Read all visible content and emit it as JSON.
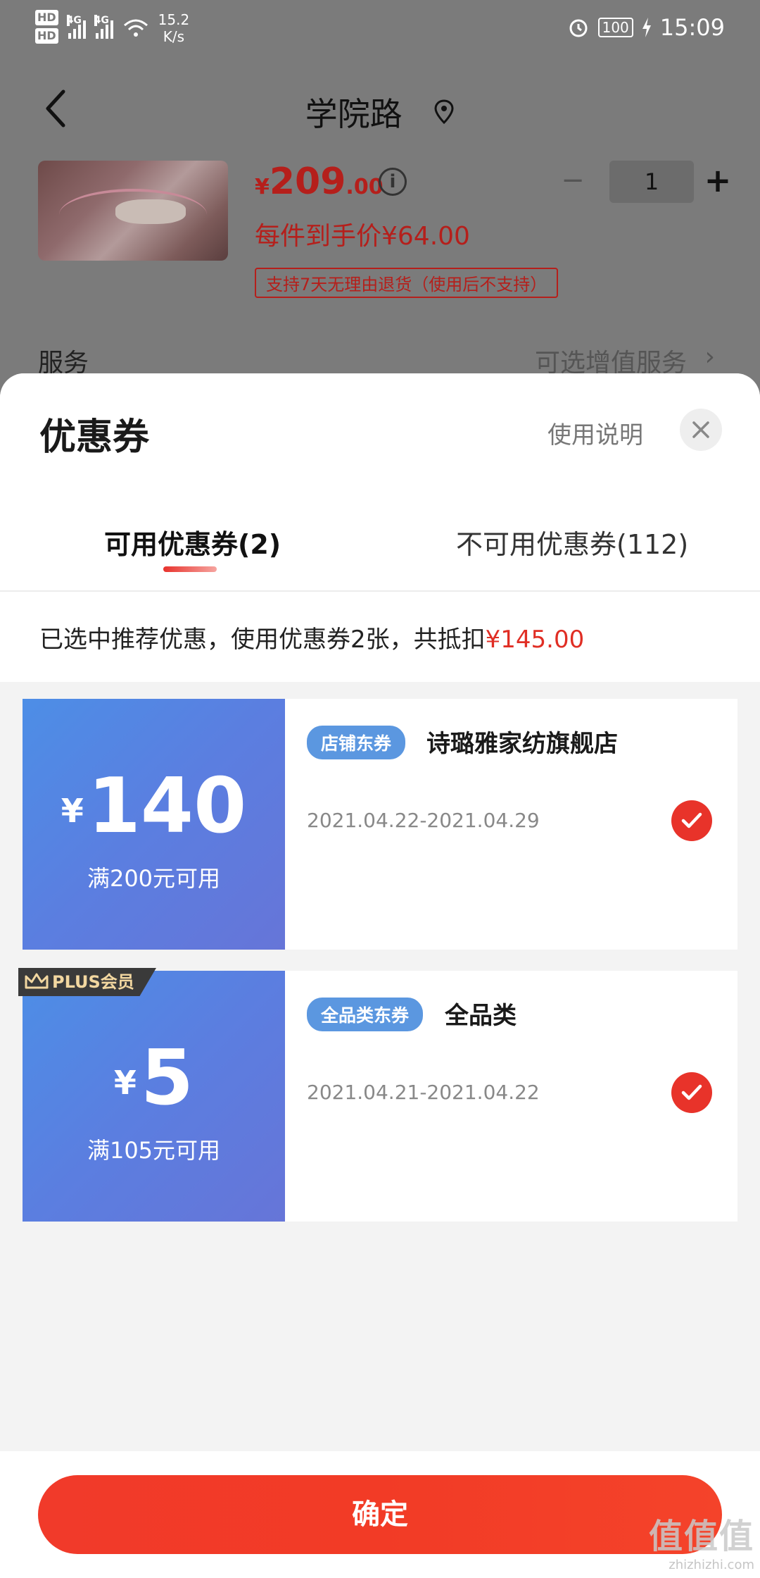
{
  "status_bar": {
    "hd1": "HD",
    "hd2": "HD",
    "net1": "4G",
    "net2": "4G",
    "speed": "15.2",
    "speed_unit": "K/s",
    "battery": "100",
    "time": "15:09"
  },
  "nav": {
    "title": "学院路"
  },
  "product": {
    "price_symbol": "¥",
    "price_int": "209",
    "price_dec": ".00",
    "quantity": "1",
    "unit_price_label": "每件到手价¥64.00",
    "return_policy": "支持7天无理由退货（使用后不支持）"
  },
  "service": {
    "label": "服务",
    "value": "可选增值服务",
    "chevron": "›"
  },
  "sheet": {
    "title": "优惠券",
    "help_link": "使用说明",
    "tabs": [
      {
        "label": "可用优惠券(2)"
      },
      {
        "label": "不可用优惠券(112)"
      }
    ],
    "summary_text": "已选中推荐优惠，使用优惠券2张，共抵扣",
    "summary_amount": "¥145.00"
  },
  "coupons": [
    {
      "symbol": "¥",
      "amount": "140",
      "condition": "满200元可用",
      "tag": "店铺东券",
      "name": "诗璐雅家纺旗舰店",
      "date": "2021.04.22-2021.04.29",
      "selected": true
    },
    {
      "badge": "PLUS会员",
      "symbol": "¥",
      "amount": "5",
      "condition": "满105元可用",
      "tag": "全品类东券",
      "name": "全品类",
      "date": "2021.04.21-2021.04.22",
      "selected": true
    }
  ],
  "confirm_label": "确定",
  "watermark": {
    "big": "值值值",
    "small": "zhizhizhi.com"
  },
  "colors": {
    "accent_red": "#e8332a",
    "coupon_blue": "#5b7ee0",
    "price_red": "#b51f1b"
  }
}
